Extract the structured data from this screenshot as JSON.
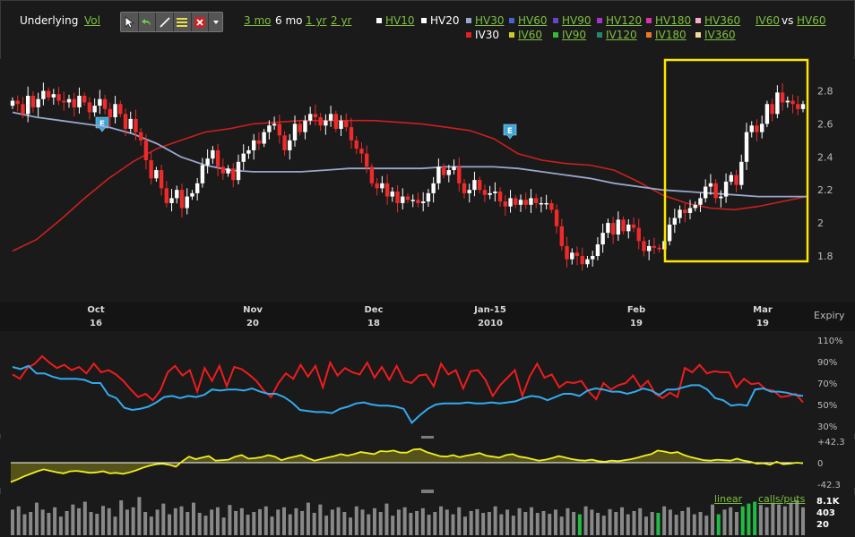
{
  "toolbar": {
    "underlying_label": "Underlying",
    "vol_link": "Vol",
    "ranges": [
      {
        "label": "3 mo",
        "active": false
      },
      {
        "label": "6 mo",
        "active": true
      },
      {
        "label": "1 yr",
        "active": false
      },
      {
        "label": "2 yr",
        "active": false
      }
    ],
    "vs_label": "vs",
    "row1": [
      {
        "label": "HV10",
        "color": "#ffffff",
        "active": true
      },
      {
        "label": "HV20",
        "color": "#33aaee",
        "active": true
      },
      {
        "label": "HV30",
        "color": "#9aa6cc",
        "active": false
      },
      {
        "label": "HV60",
        "color": "#4466cc",
        "active": false
      },
      {
        "label": "HV90",
        "color": "#6644cc",
        "active": false
      },
      {
        "label": "HV120",
        "color": "#aa33cc",
        "active": false
      },
      {
        "label": "HV180",
        "color": "#dd33aa",
        "active": false
      },
      {
        "label": "HV360",
        "color": "#ffaacc",
        "active": false
      },
      {
        "label": "IV60",
        "color": "",
        "active": false
      },
      {
        "label": "HV60",
        "color": "",
        "active": false
      }
    ],
    "row2": [
      {
        "label": "IV30",
        "color": "#dd2222",
        "active": true
      },
      {
        "label": "IV60",
        "color": "#cccc22",
        "active": false
      },
      {
        "label": "IV90",
        "color": "#33bb33",
        "active": false
      },
      {
        "label": "IV120",
        "color": "#228866",
        "active": false
      },
      {
        "label": "IV180",
        "color": "#ee7722",
        "active": false
      },
      {
        "label": "IV360",
        "color": "#eedd99",
        "active": false
      }
    ],
    "tools": [
      "pointer-icon",
      "undo-icon",
      "draw-line-icon",
      "studies-icon",
      "delete-icon",
      "dropdown-icon"
    ]
  },
  "colors": {
    "background": "#1a1a1a",
    "up_candle": "#ffffff",
    "down_candle": "#ee2a2a",
    "ma_fast": "#9aa6cc",
    "ma_slow": "#cc1f1f",
    "highlight": "#ffe500",
    "iv_line": "#ee1c1c",
    "hv_line": "#33aaee",
    "spread_line": "#eeee22",
    "spread_fill": "#55531a",
    "volume_bar": "#888888",
    "volume_green": "#22bb44",
    "axis_text": "#bbbbbb",
    "panel_divider": "#2c2c2c",
    "earnings_badge": "#3da5d6"
  },
  "chart_data": [
    {
      "type": "candlestick",
      "y_ticks": [
        "2.8",
        "2.6",
        "2.4",
        "2.2",
        "2",
        "1.8"
      ],
      "ylim": [
        1.68,
        2.88
      ],
      "x_ticks": [
        {
          "month": "Oct",
          "day": "16"
        },
        {
          "month": "Nov",
          "day": "20"
        },
        {
          "month": "Dec",
          "day": "18"
        },
        {
          "month": "Jan-15",
          "day": "2010"
        },
        {
          "month": "Feb",
          "day": "19"
        },
        {
          "month": "Mar",
          "day": "19"
        }
      ],
      "axis_right_label": "Expiry",
      "earnings_marker": "E",
      "closes": [
        2.74,
        2.72,
        2.66,
        2.77,
        2.7,
        2.75,
        2.8,
        2.76,
        2.78,
        2.74,
        2.73,
        2.75,
        2.7,
        2.77,
        2.73,
        2.67,
        2.71,
        2.75,
        2.69,
        2.64,
        2.72,
        2.66,
        2.57,
        2.63,
        2.55,
        2.5,
        2.38,
        2.27,
        2.32,
        2.21,
        2.12,
        2.15,
        2.2,
        2.09,
        2.16,
        2.18,
        2.24,
        2.35,
        2.39,
        2.44,
        2.34,
        2.3,
        2.33,
        2.26,
        2.37,
        2.42,
        2.44,
        2.5,
        2.48,
        2.55,
        2.59,
        2.6,
        2.53,
        2.44,
        2.5,
        2.6,
        2.55,
        2.62,
        2.66,
        2.64,
        2.59,
        2.62,
        2.66,
        2.57,
        2.62,
        2.58,
        2.5,
        2.45,
        2.42,
        2.34,
        2.24,
        2.21,
        2.24,
        2.16,
        2.19,
        2.12,
        2.16,
        2.14,
        2.14,
        2.12,
        2.13,
        2.18,
        2.24,
        2.34,
        2.29,
        2.32,
        2.34,
        2.24,
        2.18,
        2.2,
        2.26,
        2.2,
        2.17,
        2.18,
        2.19,
        2.13,
        2.1,
        2.15,
        2.11,
        2.14,
        2.11,
        2.15,
        2.12,
        2.12,
        2.12,
        2.08,
        1.98,
        1.86,
        1.78,
        1.82,
        1.8,
        1.75,
        1.78,
        1.8,
        1.87,
        1.94,
        2.0,
        1.93,
        2.02,
        1.95,
        1.99,
        1.97,
        1.89,
        1.83,
        1.86,
        1.85,
        1.84,
        1.89,
        1.99,
        2.03,
        2.08,
        2.06,
        2.09,
        2.11,
        2.15,
        2.22,
        2.24,
        2.15,
        2.16,
        2.25,
        2.29,
        2.23,
        2.37,
        2.55,
        2.59,
        2.55,
        2.6,
        2.72,
        2.66,
        2.79,
        2.73,
        2.74,
        2.72,
        2.69,
        2.72
      ],
      "ma_fast": [
        2.67,
        2.64,
        2.62,
        2.6,
        2.58,
        2.54,
        2.48,
        2.4,
        2.35,
        2.32,
        2.31,
        2.31,
        2.31,
        2.32,
        2.33,
        2.33,
        2.33,
        2.33,
        2.34,
        2.34,
        2.34,
        2.33,
        2.31,
        2.29,
        2.27,
        2.24,
        2.22,
        2.2,
        2.19,
        2.18,
        2.17,
        2.16,
        2.16,
        2.16
      ],
      "ma_slow": [
        1.83,
        1.9,
        2.02,
        2.15,
        2.27,
        2.37,
        2.45,
        2.5,
        2.55,
        2.57,
        2.6,
        2.61,
        2.62,
        2.62,
        2.62,
        2.62,
        2.61,
        2.6,
        2.58,
        2.56,
        2.51,
        2.42,
        2.38,
        2.36,
        2.35,
        2.32,
        2.25,
        2.17,
        2.12,
        2.09,
        2.08,
        2.1,
        2.13,
        2.16
      ]
    },
    {
      "type": "line",
      "y_ticks": [
        "110%",
        "90%",
        "70%",
        "50%",
        "30%"
      ],
      "ylim": [
        30,
        110
      ],
      "series": [
        {
          "name": "IV30",
          "values": [
            78,
            74,
            84,
            88,
            95,
            89,
            84,
            87,
            82,
            85,
            79,
            88,
            80,
            82,
            78,
            72,
            64,
            57,
            60,
            54,
            63,
            80,
            86,
            77,
            82,
            62,
            84,
            72,
            86,
            67,
            85,
            83,
            78,
            72,
            63,
            57,
            70,
            79,
            74,
            87,
            76,
            86,
            66,
            89,
            77,
            84,
            80,
            78,
            89,
            75,
            85,
            73,
            86,
            72,
            70,
            77,
            78,
            67,
            88,
            78,
            82,
            65,
            81,
            82,
            73,
            58,
            68,
            75,
            82,
            58,
            76,
            88,
            75,
            78,
            66,
            71,
            70,
            72,
            62,
            55,
            70,
            64,
            68,
            70,
            77,
            66,
            72,
            60,
            56,
            61,
            57,
            84,
            80,
            87,
            79,
            81,
            80,
            80,
            66,
            74,
            69,
            70,
            64,
            63,
            57,
            58,
            60,
            52
          ]
        },
        {
          "name": "HV20",
          "values": [
            85,
            83,
            86,
            79,
            79,
            76,
            74,
            74,
            74,
            73,
            70,
            70,
            59,
            56,
            47,
            45,
            46,
            48,
            52,
            57,
            58,
            56,
            58,
            57,
            59,
            64,
            63,
            64,
            64,
            63,
            65,
            62,
            60,
            60,
            57,
            52,
            45,
            44,
            43,
            43,
            42,
            46,
            48,
            51,
            52,
            50,
            49,
            49,
            48,
            46,
            33,
            40,
            46,
            50,
            51,
            51,
            51,
            52,
            51,
            51,
            52,
            51,
            52,
            53,
            56,
            58,
            57,
            54,
            57,
            60,
            60,
            58,
            63,
            65,
            64,
            62,
            62,
            60,
            62,
            65,
            63,
            59,
            64,
            64,
            66,
            68,
            68,
            64,
            56,
            54,
            49,
            50,
            49,
            64,
            65,
            62,
            62,
            61,
            59,
            58
          ]
        }
      ]
    },
    {
      "type": "area",
      "y_ticks": [
        "+42.3",
        "0",
        "-42.3"
      ],
      "ylim": [
        -42.3,
        42.3
      ],
      "values": [
        -38,
        -33,
        -27,
        -22,
        -17,
        -13,
        -16,
        -19,
        -21,
        -17,
        -16,
        -18,
        -20,
        -19,
        -17,
        -21,
        -20,
        -22,
        -19,
        -15,
        -10,
        -6,
        -3,
        -2,
        -4,
        -8,
        3,
        12,
        7,
        10,
        13,
        4,
        5,
        6,
        12,
        15,
        8,
        9,
        11,
        15,
        12,
        5,
        9,
        12,
        15,
        9,
        4,
        7,
        10,
        13,
        17,
        14,
        17,
        21,
        19,
        17,
        23,
        22,
        24,
        20,
        20,
        26,
        27,
        21,
        17,
        13,
        12,
        15,
        11,
        14,
        16,
        19,
        14,
        12,
        10,
        15,
        17,
        12,
        10,
        7,
        4,
        6,
        9,
        13,
        10,
        7,
        5,
        4,
        6,
        3,
        2,
        4,
        3,
        5,
        7,
        10,
        14,
        17,
        24,
        22,
        19,
        21,
        15,
        11,
        8,
        5,
        4,
        6,
        5,
        4,
        8,
        4,
        2,
        -2,
        -1,
        -4,
        2,
        -3,
        -2,
        0,
        -1
      ]
    },
    {
      "type": "bar",
      "axis_labels": [
        "8.1K",
        "403",
        "20"
      ],
      "links": [
        "linear",
        "calls/puts"
      ],
      "values": [
        0.55,
        0.62,
        0.45,
        0.5,
        0.7,
        0.55,
        0.48,
        0.6,
        0.4,
        0.52,
        0.66,
        0.58,
        0.72,
        0.5,
        0.46,
        0.63,
        0.58,
        0.4,
        0.75,
        0.55,
        0.6,
        0.82,
        0.5,
        0.4,
        0.55,
        0.68,
        0.45,
        0.58,
        0.62,
        0.5,
        0.7,
        0.48,
        0.42,
        0.55,
        0.6,
        0.38,
        0.65,
        0.52,
        0.58,
        0.44,
        0.5,
        0.56,
        0.62,
        0.4,
        0.55,
        0.6,
        0.45,
        0.58,
        0.52,
        0.7,
        0.48,
        0.66,
        0.42,
        0.55,
        0.6,
        0.5,
        0.38,
        0.62,
        0.55,
        0.45,
        0.58,
        0.5,
        0.68,
        0.42,
        0.55,
        0.6,
        0.48,
        0.52,
        0.58,
        0.44,
        0.5,
        0.62,
        0.55,
        0.45,
        0.6,
        0.4,
        0.52,
        0.56,
        0.48,
        0.5,
        0.62,
        0.45,
        0.55,
        0.42,
        0.58,
        0.5,
        0.6,
        0.48,
        0.52,
        0.46,
        0.55,
        0.4,
        0.58,
        0.5,
        0.45,
        0.62,
        0.55,
        0.48,
        0.42,
        0.56,
        0.5,
        0.6,
        0.45,
        0.52,
        0.58,
        0.4,
        0.5,
        0.48,
        0.62,
        0.55,
        0.44,
        0.52,
        0.6,
        0.45,
        0.5,
        0.42,
        0.66,
        0.45,
        0.55,
        0.6,
        0.5,
        0.62,
        0.68,
        0.72,
        0.65,
        0.6,
        0.7,
        0.66,
        0.62,
        0.7,
        0.75,
        0.6
      ],
      "green_indices": [
        94,
        107,
        117,
        121,
        122,
        123
      ]
    }
  ]
}
